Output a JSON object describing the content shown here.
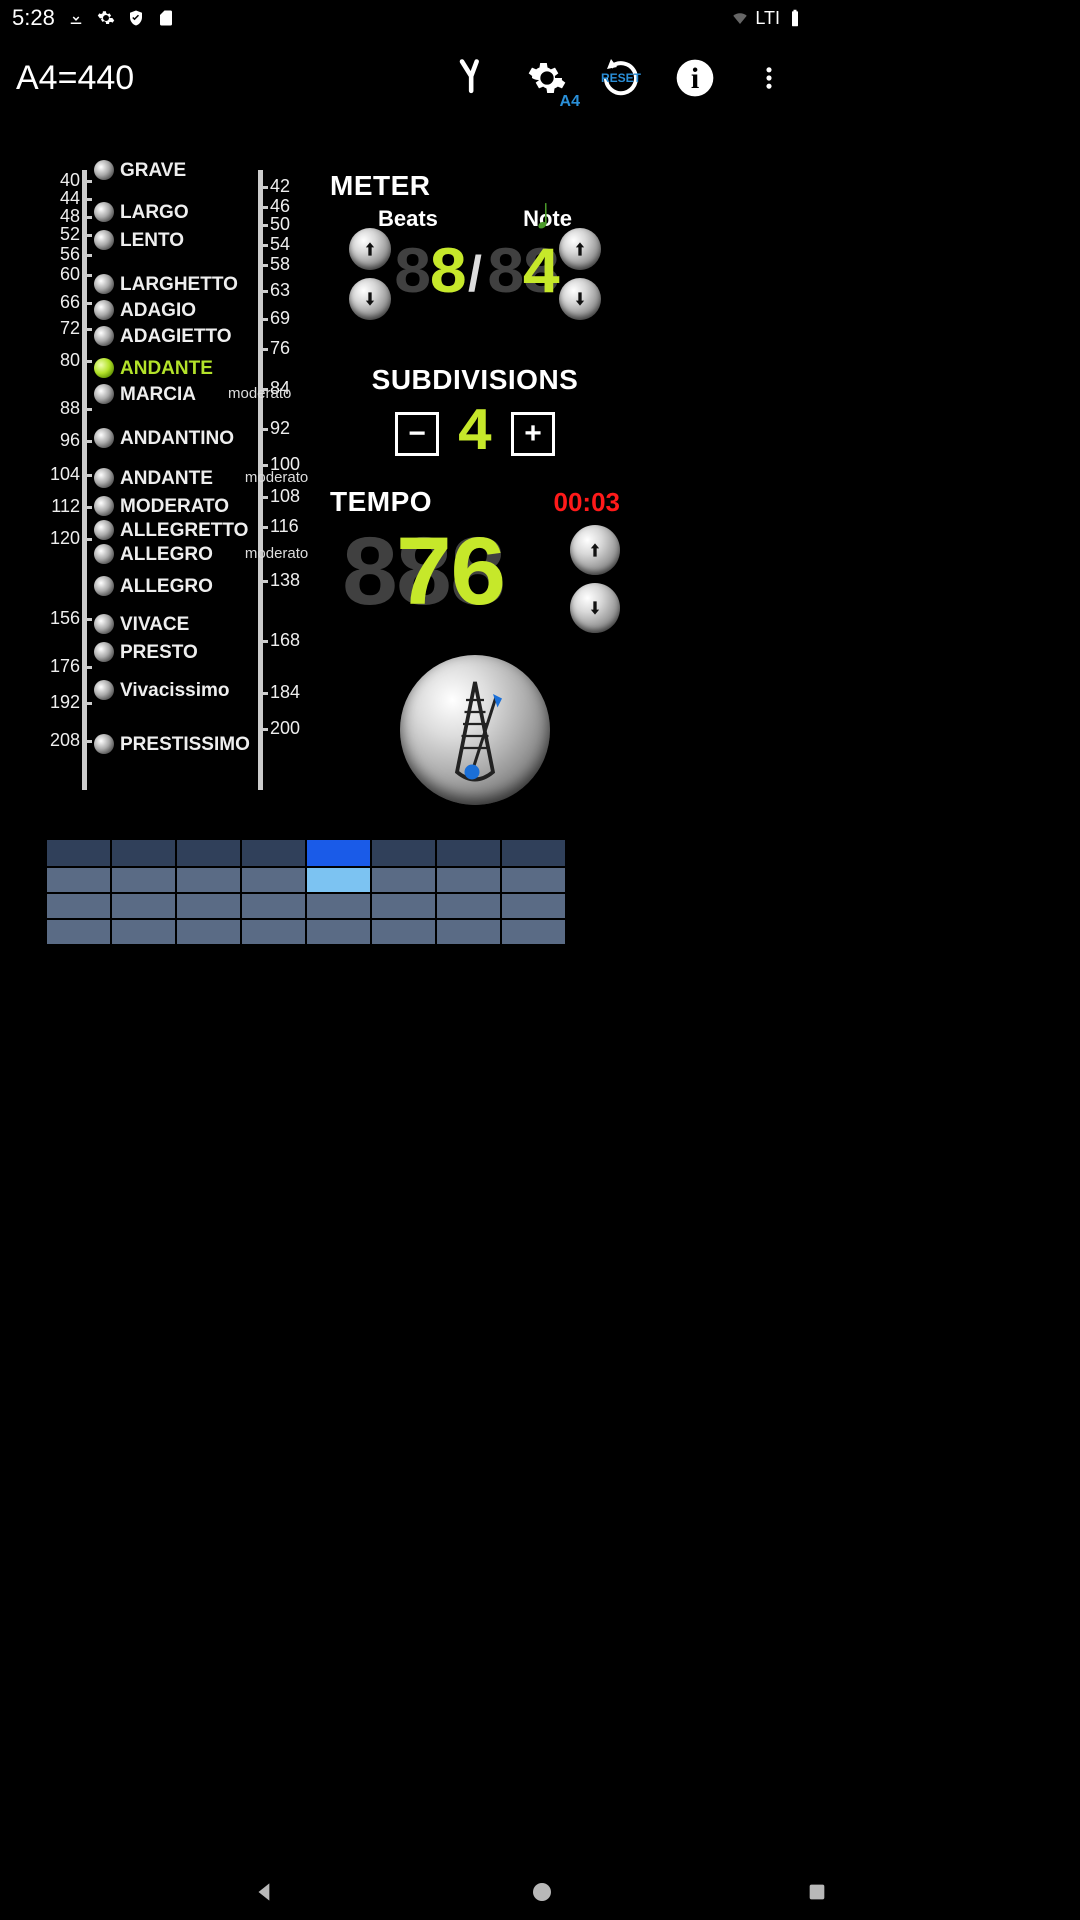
{
  "status": {
    "time": "5:28",
    "net": "LTI"
  },
  "toolbar": {
    "title": "A4=440",
    "settings_sub": "A4",
    "reset_label": "RESET"
  },
  "scale": {
    "left_ticks": [
      "40",
      "44",
      "48",
      "52",
      "56",
      "60",
      "66",
      "72",
      "80",
      "88",
      "96",
      "104",
      "112",
      "120",
      "156",
      "176",
      "192",
      "208"
    ],
    "right_ticks": [
      "42",
      "46",
      "50",
      "54",
      "58",
      "63",
      "69",
      "76",
      "84",
      "92",
      "100",
      "108",
      "116",
      "138",
      "168",
      "184",
      "200"
    ],
    "tempi": [
      {
        "label": "GRAVE"
      },
      {
        "label": "LARGO"
      },
      {
        "label": "LENTO"
      },
      {
        "label": "LARGHETTO"
      },
      {
        "label": "ADAGIO"
      },
      {
        "label": "ADAGIETTO"
      },
      {
        "label": "ANDANTE",
        "selected": true
      },
      {
        "label": "MARCIA",
        "sub": "moderato"
      },
      {
        "label": "ANDANTINO"
      },
      {
        "label": "ANDANTE",
        "sub": "moderato"
      },
      {
        "label": "MODERATO"
      },
      {
        "label": "ALLEGRETTO"
      },
      {
        "label": "ALLEGRO",
        "sub": "moderato"
      },
      {
        "label": "ALLEGRO"
      },
      {
        "label": "VIVACE"
      },
      {
        "label": "PRESTO"
      },
      {
        "label": "Vivacissimo"
      },
      {
        "label": "PRESTISSIMO"
      }
    ]
  },
  "meter": {
    "title": "METER",
    "beats_label": "Beats",
    "note_label": "Note",
    "beats_ghost": "88",
    "beats_value": "8",
    "note_ghost": "88",
    "note_value": "4"
  },
  "subdivisions": {
    "title": "SUBDIVISIONS",
    "value": "4"
  },
  "tempo": {
    "title": "TEMPO",
    "timer": "00:03",
    "ghost": "888",
    "value": "76"
  },
  "grid": {
    "cols": 8,
    "active_col": 4
  }
}
